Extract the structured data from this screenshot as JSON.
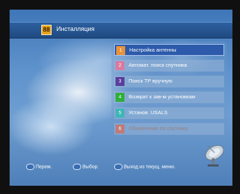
{
  "header": {
    "icon": "88",
    "title": "Инсталляция"
  },
  "menu": {
    "items": [
      {
        "num": "1",
        "label": "Настройка антенны",
        "color": "#e8923a",
        "selected": true,
        "disabled": false
      },
      {
        "num": "2",
        "label": "Автомат. поиск спутника",
        "color": "#d97aa0",
        "selected": false,
        "disabled": false
      },
      {
        "num": "3",
        "label": "Поиск TP вручную",
        "color": "#5a3e9c",
        "selected": false,
        "disabled": false
      },
      {
        "num": "4",
        "label": "Возврат к зав-м установкам",
        "color": "#2fae3c",
        "selected": false,
        "disabled": false
      },
      {
        "num": "5",
        "label": "Установ. USALS",
        "color": "#3fb6b6",
        "selected": false,
        "disabled": false
      },
      {
        "num": "6",
        "label": "Обновление по спутнику",
        "color": "#c07a7a",
        "selected": false,
        "disabled": true
      }
    ]
  },
  "footer": {
    "move": "Перем.",
    "select": "Выбор.",
    "exit": "Выход из текущ. меню."
  },
  "icons": {
    "dish": "satellite-dish-icon"
  }
}
